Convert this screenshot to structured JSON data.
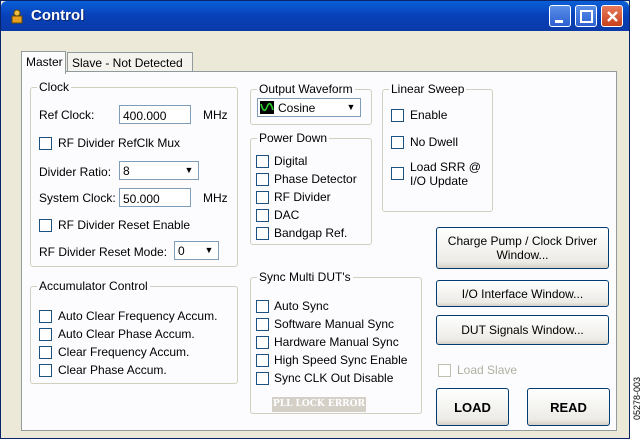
{
  "window": {
    "title": "Control"
  },
  "tabs": [
    "Master",
    "Slave - Not Detected"
  ],
  "clock": {
    "title": "Clock",
    "ref_clock_label": "Ref Clock:",
    "ref_clock_value": "400.000",
    "ref_clock_unit": "MHz",
    "rf_divider_refclk_mux": "RF Divider RefClk Mux",
    "divider_ratio_label": "Divider Ratio:",
    "divider_ratio_value": "8",
    "system_clock_label": "System Clock:",
    "system_clock_value": "50.000",
    "system_clock_unit": "MHz",
    "rf_divider_reset_enable": "RF Divider Reset Enable",
    "rf_divider_reset_mode_label": "RF Divider Reset Mode:",
    "rf_divider_reset_mode_value": "0"
  },
  "output_waveform": {
    "title": "Output Waveform",
    "value": "Cosine"
  },
  "power_down": {
    "title": "Power Down",
    "items": [
      "Digital",
      "Phase Detector",
      "RF Divider",
      "DAC",
      "Bandgap Ref."
    ]
  },
  "linear_sweep": {
    "title": "Linear Sweep",
    "enable": "Enable",
    "no_dwell": "No Dwell",
    "load_srr_line1": "Load SRR @",
    "load_srr_line2": "I/O Update"
  },
  "accumulator": {
    "title": "Accumulator Control",
    "items": [
      "Auto Clear Frequency Accum.",
      "Auto Clear Phase Accum.",
      "Clear Frequency Accum.",
      "Clear Phase Accum."
    ]
  },
  "sync": {
    "title": "Sync Multi DUT's",
    "items": [
      "Auto Sync",
      "Software Manual Sync",
      "Hardware Manual Sync",
      "High Speed Sync Enable",
      "Sync CLK Out Disable"
    ],
    "pll_lock_error": "PLL LOCK ERROR"
  },
  "buttons": {
    "charge_pump_line1": "Charge Pump / Clock Driver",
    "charge_pump_line2": "Window...",
    "io_interface": "I/O Interface Window...",
    "dut_signals": "DUT Signals Window...",
    "load_slave": "Load Slave",
    "load": "LOAD",
    "read": "READ"
  },
  "side_code": "05278-003",
  "colors": {
    "title_bar": "#0a4fc8",
    "panel_bg": "#fcfcfe",
    "dialog_bg": "#ece9d8",
    "waveform_icon": "#1a8a1a"
  },
  "icons": [
    "app-icon",
    "minimize-icon",
    "maximize-icon",
    "close-icon",
    "chevron-down-icon",
    "waveform-icon"
  ]
}
